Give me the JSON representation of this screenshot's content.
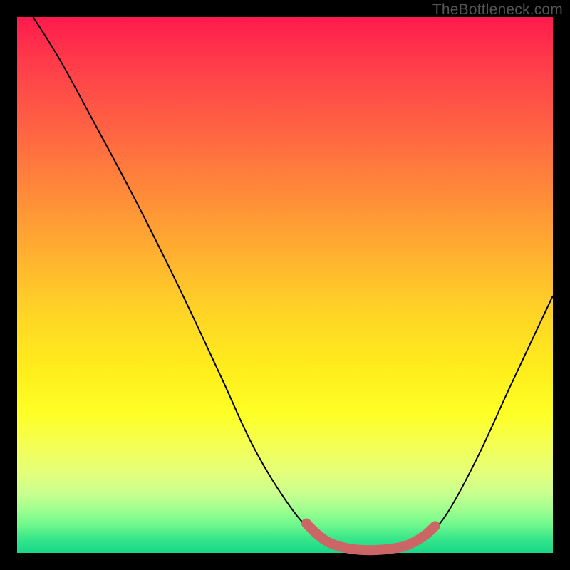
{
  "watermark": "TheBottleneck.com",
  "chart_data": {
    "type": "line",
    "title": "",
    "xlabel": "",
    "ylabel": "",
    "xlim": [
      0,
      100
    ],
    "ylim": [
      0,
      100
    ],
    "series": [
      {
        "name": "curve",
        "stroke": "#000000",
        "stroke_width": 2,
        "points": [
          {
            "x": 3,
            "y": 100
          },
          {
            "x": 8,
            "y": 92
          },
          {
            "x": 14,
            "y": 81
          },
          {
            "x": 22,
            "y": 66
          },
          {
            "x": 30,
            "y": 50
          },
          {
            "x": 38,
            "y": 33
          },
          {
            "x": 44,
            "y": 20
          },
          {
            "x": 50,
            "y": 10
          },
          {
            "x": 55,
            "y": 4
          },
          {
            "x": 60,
            "y": 1
          },
          {
            "x": 66,
            "y": 0.5
          },
          {
            "x": 72,
            "y": 1
          },
          {
            "x": 76,
            "y": 3
          },
          {
            "x": 80,
            "y": 7
          },
          {
            "x": 86,
            "y": 18
          },
          {
            "x": 92,
            "y": 31
          },
          {
            "x": 100,
            "y": 48
          }
        ]
      },
      {
        "name": "threshold-band",
        "stroke": "#cc6666",
        "stroke_width": 14,
        "linecap": "round",
        "points": [
          {
            "x": 54,
            "y": 5.5
          },
          {
            "x": 56,
            "y": 3.5
          },
          {
            "x": 58.5,
            "y": 1.8
          },
          {
            "x": 62,
            "y": 0.8
          },
          {
            "x": 66,
            "y": 0.5
          },
          {
            "x": 70,
            "y": 0.8
          },
          {
            "x": 73,
            "y": 1.5
          },
          {
            "x": 76,
            "y": 3.2
          },
          {
            "x": 78,
            "y": 5
          }
        ]
      }
    ],
    "markers": [
      {
        "series": "threshold-band",
        "x": 54,
        "y": 5.5,
        "r": 7,
        "fill": "#cc6666"
      },
      {
        "series": "threshold-band",
        "x": 56,
        "y": 3.5,
        "r": 7,
        "fill": "#cc6666"
      }
    ]
  }
}
